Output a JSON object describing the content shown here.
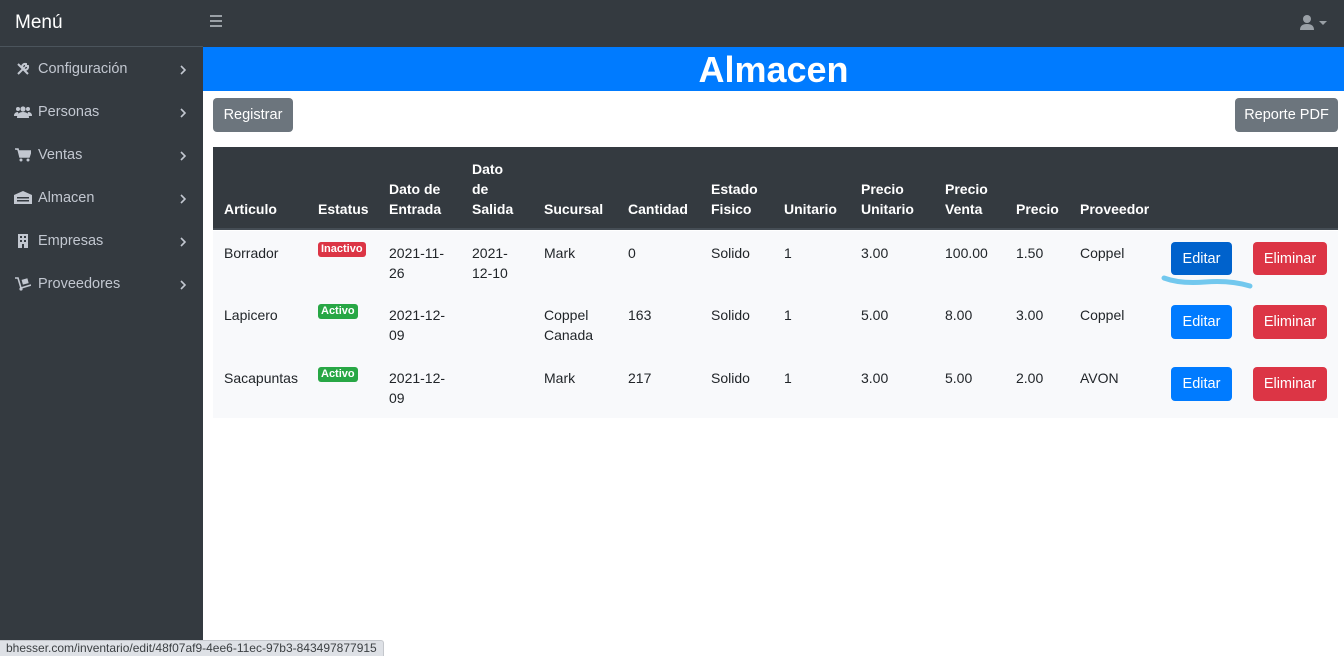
{
  "brand": "Menú",
  "sidebar": {
    "items": [
      {
        "label": "Configuración",
        "icon": "tools-icon"
      },
      {
        "label": "Personas",
        "icon": "users-icon"
      },
      {
        "label": "Ventas",
        "icon": "cart-icon"
      },
      {
        "label": "Almacen",
        "icon": "warehouse-icon"
      },
      {
        "label": "Empresas",
        "icon": "building-icon"
      },
      {
        "label": "Proveedores",
        "icon": "dolly-icon"
      }
    ]
  },
  "page": {
    "title": "Almacen",
    "register_label": "Registrar",
    "report_label": "Reporte PDF"
  },
  "table": {
    "headers": [
      "Articulo",
      "Estatus",
      "Dato de Entrada",
      "Dato de Salida",
      "Sucursal",
      "Cantidad",
      "Estado Fisico",
      "Unitario",
      "Precio Unitario",
      "Precio Venta",
      "Precio",
      "Proveedor"
    ],
    "edit_label": "Editar",
    "delete_label": "Eliminar",
    "rows": [
      {
        "articulo": "Borrador",
        "estatus": "Inactivo",
        "entrada": "2021-11-26",
        "salida": "2021-12-10",
        "sucursal": "Mark",
        "cantidad": "0",
        "estado": "Solido",
        "unitario": "1",
        "precio_unitario": "3.00",
        "precio_venta": "100.00",
        "precio": "1.50",
        "proveedor": "Coppel"
      },
      {
        "articulo": "Lapicero",
        "estatus": "Activo",
        "entrada": "2021-12-09",
        "salida": "",
        "sucursal": "Coppel Canada",
        "cantidad": "163",
        "estado": "Solido",
        "unitario": "1",
        "precio_unitario": "5.00",
        "precio_venta": "8.00",
        "precio": "3.00",
        "proveedor": "Coppel"
      },
      {
        "articulo": "Sacapuntas",
        "estatus": "Activo",
        "entrada": "2021-12-09",
        "salida": "",
        "sucursal": "Mark",
        "cantidad": "217",
        "estado": "Solido",
        "unitario": "1",
        "precio_unitario": "3.00",
        "precio_venta": "5.00",
        "precio": "2.00",
        "proveedor": "AVON"
      }
    ]
  },
  "statusbar": "bhesser.com/inventario/edit/48f07af9-4ee6-11ec-97b3-843497877915",
  "colors": {
    "primary": "#007bff",
    "danger": "#dc3545",
    "success": "#28a745",
    "dark": "#343a40",
    "secondary": "#6c757d"
  }
}
